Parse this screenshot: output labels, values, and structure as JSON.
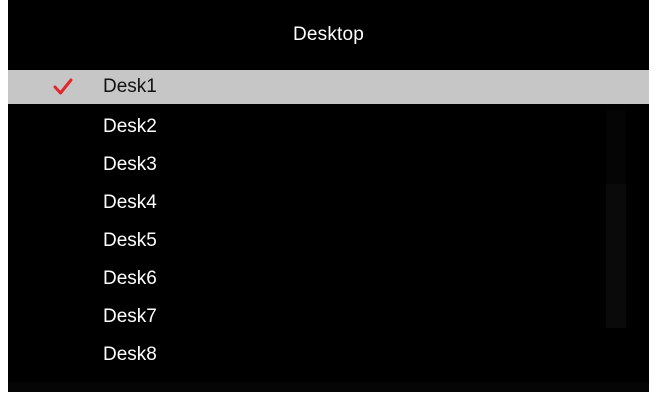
{
  "menu": {
    "title": "Desktop",
    "selected_index": 0,
    "items": [
      {
        "label": "Desk1",
        "checked": true
      },
      {
        "label": "Desk2",
        "checked": false
      },
      {
        "label": "Desk3",
        "checked": false
      },
      {
        "label": "Desk4",
        "checked": false
      },
      {
        "label": "Desk5",
        "checked": false
      },
      {
        "label": "Desk6",
        "checked": false
      },
      {
        "label": "Desk7",
        "checked": false
      },
      {
        "label": "Desk8",
        "checked": false
      }
    ]
  },
  "icons": {
    "check": "checkmark-icon"
  },
  "colors": {
    "background": "#000000",
    "selection": "#c6c6c6",
    "check": "#e3262b",
    "text": "#ffffff",
    "selected_text": "#111111"
  }
}
